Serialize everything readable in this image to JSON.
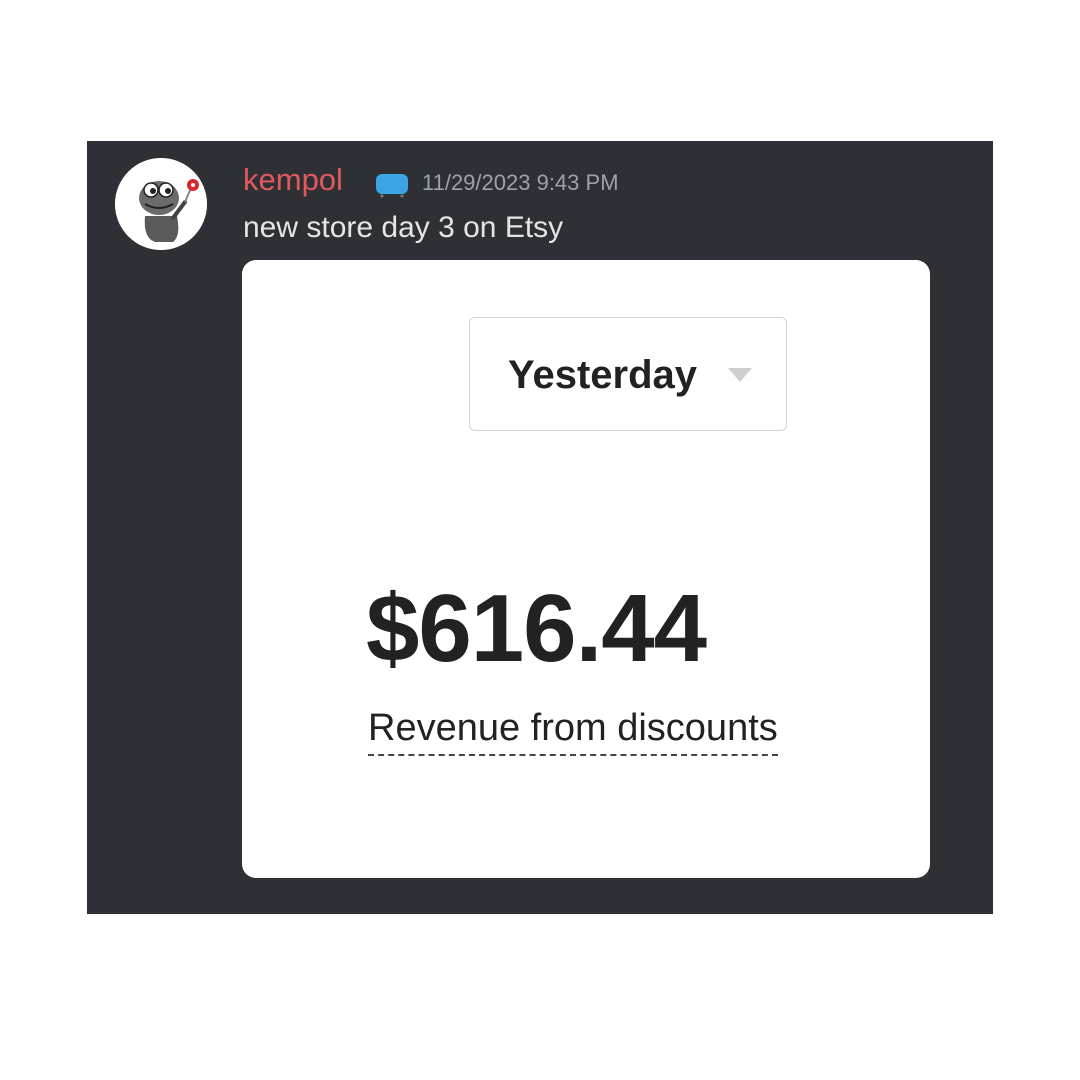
{
  "message": {
    "author": {
      "username": "kempol",
      "name_color": "#e05a5c",
      "avatar_icon": "frog-avatar-icon",
      "role_badge_icon": "chat-badge-icon",
      "role_badge_color": "#3ba5e6"
    },
    "timestamp": "11/29/2023 9:43 PM",
    "text": "new store day 3 on Etsy"
  },
  "attachment": {
    "period_select": {
      "value": "Yesterday",
      "icon": "caret-down-icon"
    },
    "metric": {
      "value": "$616.44",
      "label": "Revenue from discounts"
    }
  },
  "colors": {
    "background": "#2f3035",
    "text": "#e3e5e8",
    "muted": "#9ea2a8",
    "card": "#ffffff",
    "card_text": "#222222"
  }
}
